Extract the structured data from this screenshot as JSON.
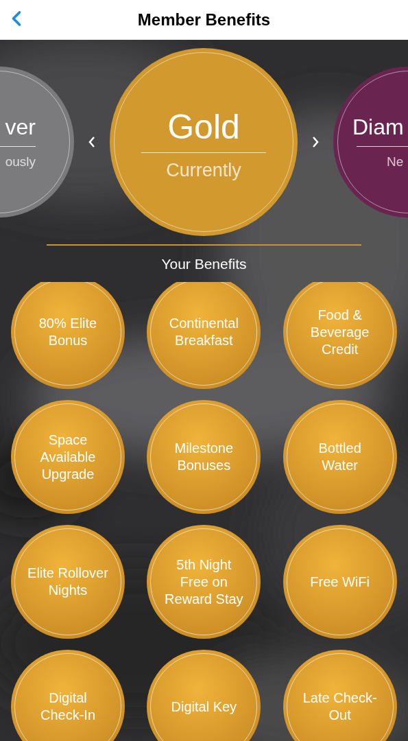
{
  "header": {
    "title": "Member Benefits"
  },
  "tiers": [
    {
      "name": "ver",
      "status": "ously",
      "color": "#7b7b7d",
      "selected": false
    },
    {
      "name": "Gold",
      "status": "Currently",
      "color": "#d29a2e",
      "selected": true
    },
    {
      "name": "Diam",
      "status": "Ne",
      "color": "#6a2450",
      "selected": false
    }
  ],
  "benefits_title": "Your Benefits",
  "benefits": [
    {
      "lines": [
        "80% Elite",
        "Bonus"
      ]
    },
    {
      "lines": [
        "Continental",
        "Breakfast"
      ]
    },
    {
      "lines": [
        "Food &",
        "Beverage",
        "Credit"
      ]
    },
    {
      "lines": [
        "Space",
        "Available",
        "Upgrade"
      ]
    },
    {
      "lines": [
        "Milestone",
        "Bonuses"
      ]
    },
    {
      "lines": [
        "Bottled",
        "Water"
      ]
    },
    {
      "lines": [
        "Elite Rollover",
        "Nights"
      ]
    },
    {
      "lines": [
        "5th Night",
        "Free on",
        "Reward Stay"
      ]
    },
    {
      "lines": [
        "Free WiFi"
      ]
    },
    {
      "lines": [
        "Digital",
        "Check-In"
      ]
    },
    {
      "lines": [
        "Digital Key"
      ]
    },
    {
      "lines": [
        "Late Check-",
        "Out"
      ]
    }
  ]
}
